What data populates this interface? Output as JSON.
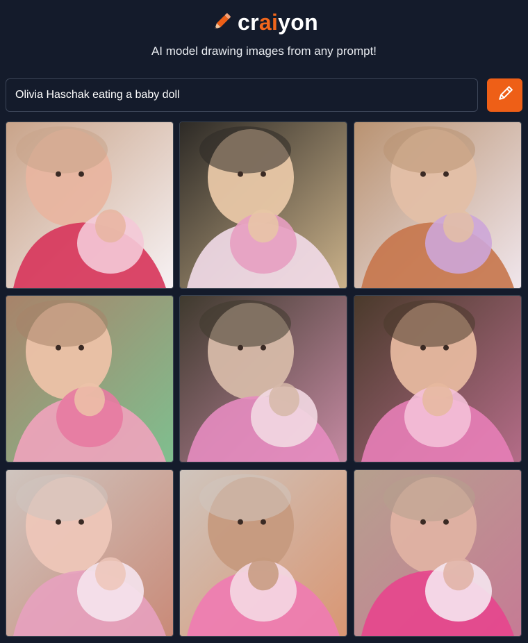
{
  "brand": {
    "prefix": "cr",
    "highlight": "ai",
    "suffix": "yon"
  },
  "tagline": "AI model drawing images from any prompt!",
  "prompt": {
    "value": "Olivia Haschak eating a baby doll"
  },
  "draw_button": {
    "icon": "pencil-icon"
  },
  "colors": {
    "background": "#141b2b",
    "accent": "#ee5f17",
    "border": "#3d4659"
  },
  "results": [
    {
      "id": "result-1",
      "palette": [
        "#c9a48a",
        "#e8b5a0",
        "#d7345a",
        "#f4c9d7",
        "#f7f2f4"
      ]
    },
    {
      "id": "result-2",
      "palette": [
        "#2d2a26",
        "#e8c7a6",
        "#f2dce9",
        "#e79ec1",
        "#cbb28a"
      ]
    },
    {
      "id": "result-3",
      "palette": [
        "#b99372",
        "#e3bfa6",
        "#c6764b",
        "#cda6d8",
        "#f0e6ec"
      ]
    },
    {
      "id": "result-4",
      "palette": [
        "#a8836a",
        "#ecc2a8",
        "#f0a3bd",
        "#e77aa1",
        "#7fbf8f"
      ]
    },
    {
      "id": "result-5",
      "palette": [
        "#3f3a2e",
        "#d6b9a8",
        "#e58cc0",
        "#f2d8e2",
        "#c68aa3"
      ]
    },
    {
      "id": "result-6",
      "palette": [
        "#4a3a2b",
        "#e6b89f",
        "#e77eb7",
        "#f4c0d8",
        "#b46c88"
      ]
    },
    {
      "id": "result-7",
      "palette": [
        "#cfc5bf",
        "#edc6b8",
        "#e7a1bf",
        "#f5e4ee",
        "#c98a78"
      ]
    },
    {
      "id": "result-8",
      "palette": [
        "#cfc5bd",
        "#c69a7e",
        "#ef7bb3",
        "#f4d8e3",
        "#d99673"
      ]
    },
    {
      "id": "result-9",
      "palette": [
        "#b6a08e",
        "#dfb2a3",
        "#e7458d",
        "#f5e6ef",
        "#c67b95"
      ]
    }
  ]
}
